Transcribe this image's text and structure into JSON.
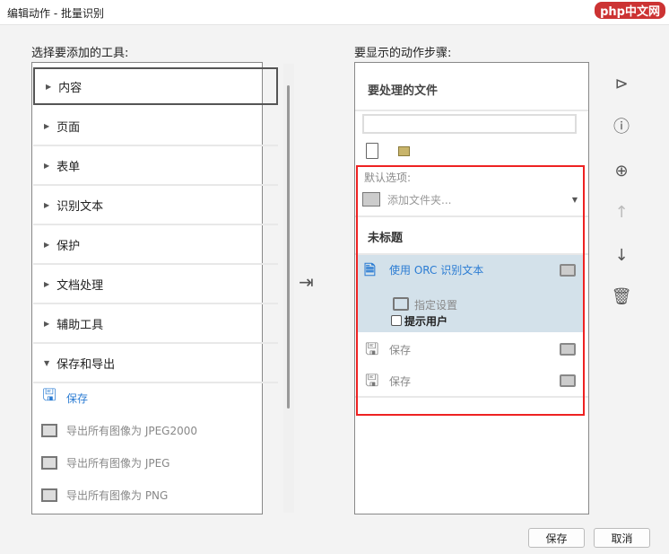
{
  "window": {
    "title": "编辑动作 - 批量识别",
    "watermark": "php中文网"
  },
  "left": {
    "label": "选择要添加的工具:",
    "categories": [
      "内容",
      "页面",
      "表单",
      "识别文本",
      "保护",
      "文档处理",
      "辅助工具",
      "保存和导出"
    ],
    "items": [
      {
        "label": "保存",
        "icon": "save-icon"
      },
      {
        "label": "导出所有图像为 JPEG2000",
        "icon": "export-image-icon"
      },
      {
        "label": "导出所有图像为 JPEG",
        "icon": "export-image-icon"
      },
      {
        "label": "导出所有图像为 PNG",
        "icon": "export-image-icon"
      }
    ]
  },
  "right": {
    "label": "要显示的动作步骤:",
    "files_header": "要处理的文件",
    "file_input": "",
    "default_options": "默认选项:",
    "add_folder": "添加文件夹...",
    "section": "未标题",
    "ocr_step": "使用 ORC 识别文本",
    "specify_settings": "指定设置",
    "prompt_user": "提示用户",
    "save1": "保存",
    "save2": "保存"
  },
  "buttons": {
    "save": "保存",
    "cancel": "取消"
  },
  "colors": {
    "accent": "#2b7cd3",
    "highlight": "#d3e1ea",
    "red": "#e22222"
  }
}
